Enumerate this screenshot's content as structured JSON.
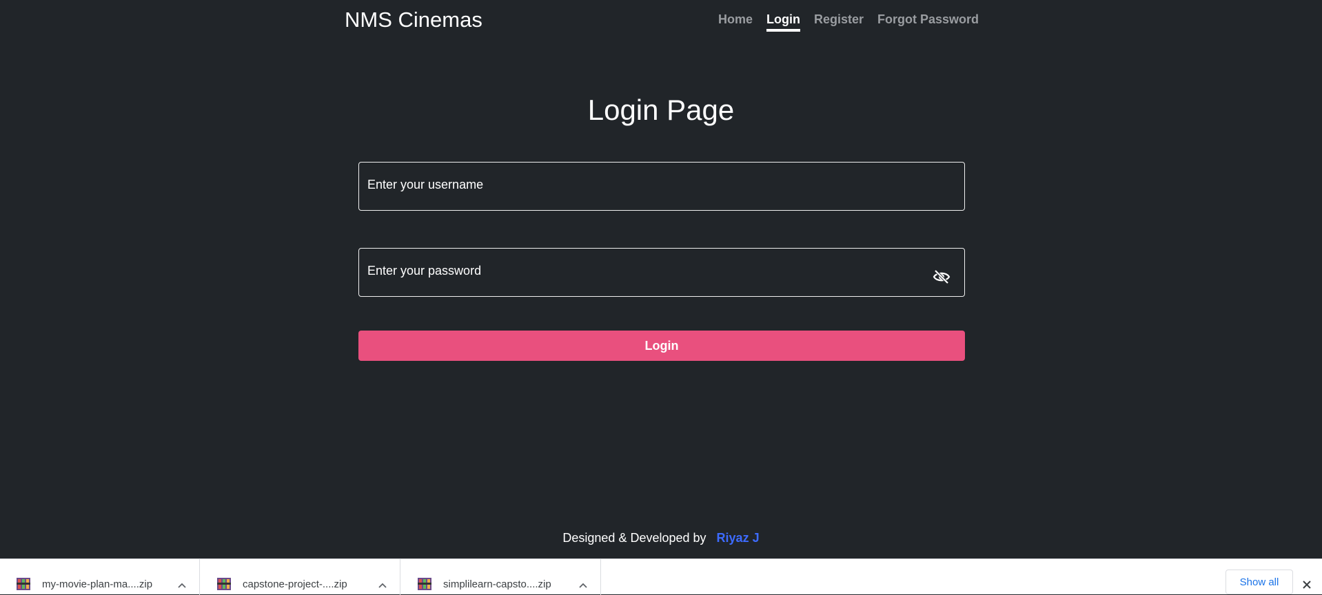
{
  "navbar": {
    "brand": "NMS Cinemas",
    "links": [
      {
        "label": "Home",
        "active": false
      },
      {
        "label": "Login",
        "active": true
      },
      {
        "label": "Register",
        "active": false
      },
      {
        "label": "Forgot Password",
        "active": false
      }
    ]
  },
  "main": {
    "title": "Login Page",
    "username_placeholder": "Enter your username",
    "password_placeholder": "Enter your password",
    "login_button": "Login",
    "password_toggle_icon": "eye-slash-icon"
  },
  "footer": {
    "text": "Designed & Developed by",
    "author": "Riyaz J"
  },
  "downloads": {
    "items": [
      {
        "name": "my-movie-plan-ma....zip"
      },
      {
        "name": "capstone-project-....zip"
      },
      {
        "name": "simplilearn-capsto....zip"
      }
    ],
    "show_all": "Show all"
  },
  "colors": {
    "background": "#212529",
    "accent": "#e9507e",
    "author_link": "#3d6bff",
    "show_all": "#1a73e8"
  }
}
